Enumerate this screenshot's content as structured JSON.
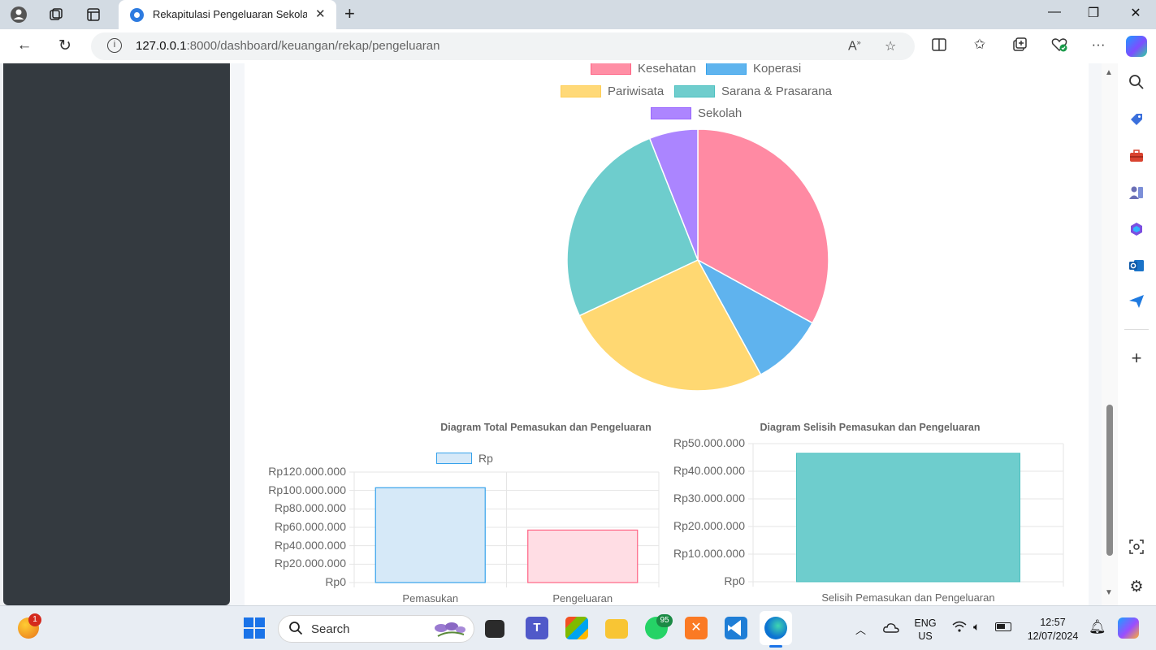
{
  "browser": {
    "tab_title": "Rekapitulasi Pengeluaran Sekolah",
    "url_host": "127.0.0.1",
    "url_rest": ":8000/dashboard/keuangan/rekap/pengeluaran"
  },
  "pie_chart": {
    "legend": [
      {
        "label": "Kesehatan",
        "color": "#ff6384"
      },
      {
        "label": "Koperasi",
        "color": "#36a2eb"
      },
      {
        "label": "Pariwisata",
        "color": "#ffce56"
      },
      {
        "label": "Sarana & Prasarana",
        "color": "#4bc0c0"
      },
      {
        "label": "Sekolah",
        "color": "#9966ff"
      }
    ]
  },
  "chart_data": [
    {
      "type": "pie",
      "categories": [
        "Kesehatan",
        "Koperasi",
        "Pariwisata",
        "Sarana & Prasarana",
        "Sekolah"
      ],
      "values": [
        33,
        9,
        26,
        26,
        6
      ],
      "colors": [
        "#ff6384",
        "#36a2eb",
        "#ffce56",
        "#4bc0c0",
        "#9966ff"
      ],
      "legend": "top"
    },
    {
      "type": "bar",
      "title": "Diagram Total Pemasukan dan Pengeluaran",
      "categories": [
        "Pemasukan",
        "Pengeluaran"
      ],
      "series": [
        {
          "name": "Rp",
          "values": [
            103000000,
            57000000
          ]
        }
      ],
      "bar_fill": [
        "#d6e9f8",
        "#ffdde4"
      ],
      "bar_stroke": [
        "#36a2eb",
        "#ff6384"
      ],
      "ylim": [
        0,
        120000000
      ],
      "yticks": [
        "Rp120.000.000",
        "Rp100.000.000",
        "Rp80.000.000",
        "Rp60.000.000",
        "Rp40.000.000",
        "Rp20.000.000",
        "Rp0"
      ],
      "legend": "top",
      "grid": true
    },
    {
      "type": "bar",
      "title": "Diagram Selisih Pemasukan dan Pengeluaran",
      "categories": [
        "Selisih Pemasukan dan Pengeluaran"
      ],
      "values": [
        46500000
      ],
      "bar_fill": "#6ecdcd",
      "ylim": [
        0,
        50000000
      ],
      "yticks": [
        "Rp50.000.000",
        "Rp40.000.000",
        "Rp30.000.000",
        "Rp20.000.000",
        "Rp10.000.000",
        "Rp0"
      ],
      "grid": true
    }
  ],
  "taskbar": {
    "search_label": "Search",
    "notification_count": "1",
    "whatsapp_badge": "95",
    "lang_top": "ENG",
    "lang_bottom": "US",
    "time": "12:57",
    "date": "12/07/2024"
  }
}
